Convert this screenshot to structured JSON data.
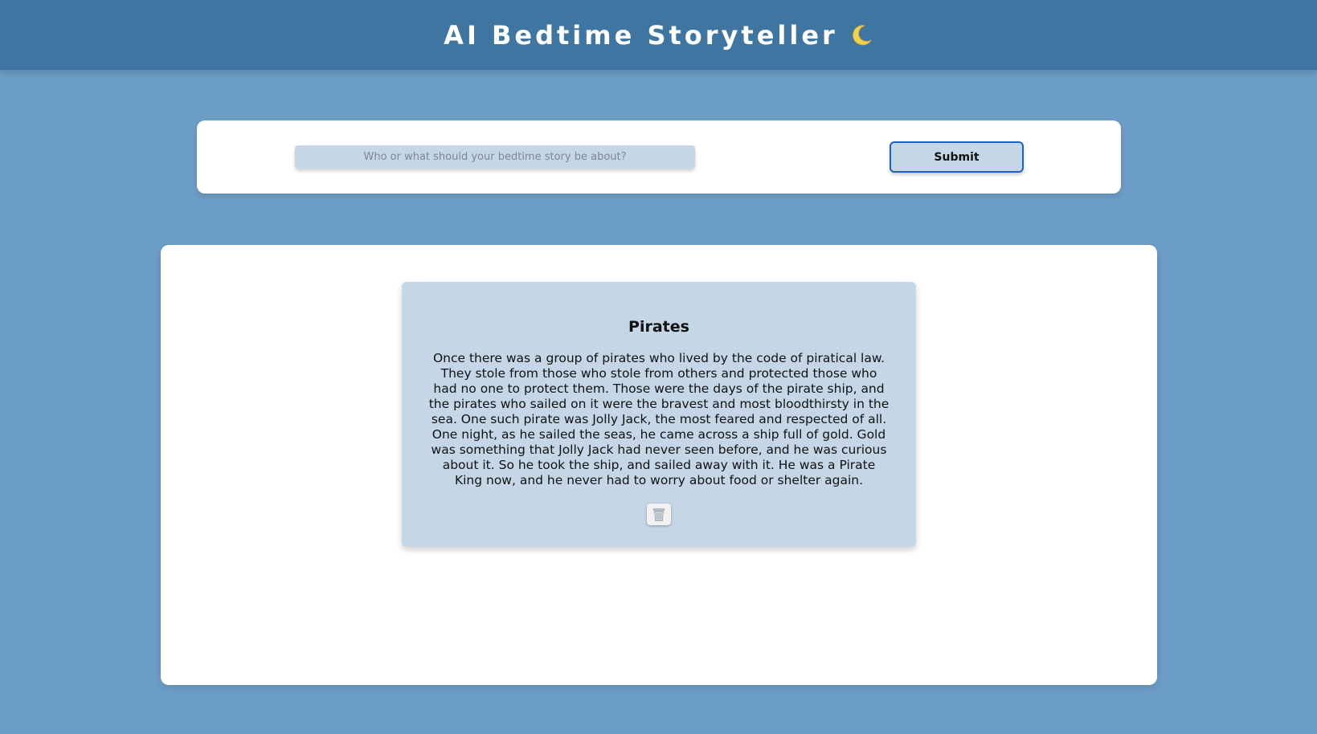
{
  "header": {
    "title": "AI Bedtime Storyteller",
    "icon": "crescent-moon-icon"
  },
  "form": {
    "input_placeholder": "Who or what should your bedtime story be about?",
    "input_value": "",
    "submit_label": "Submit"
  },
  "stories": [
    {
      "title": "Pirates",
      "text": "Once there was a group of pirates who lived by the code of piratical law. They stole from those who stole from others and protected those who had no one to protect them. Those were the days of the pirate ship, and the pirates who sailed on it were the bravest and most bloodthirsty in the sea. One such pirate was Jolly Jack, the most feared and respected of all. One night, as he sailed the seas, he came across a ship full of gold. Gold was something that Jolly Jack had never seen before, and he was curious about it. So he took the ship, and sailed away with it. He was a Pirate King now, and he never had to worry about food or shelter again.",
      "delete_icon": "trash-icon"
    }
  ],
  "colors": {
    "background": "#6c9dc6",
    "header": "#3f76a1",
    "card": "#c5d7e6",
    "submit_border": "#1f62c7"
  }
}
